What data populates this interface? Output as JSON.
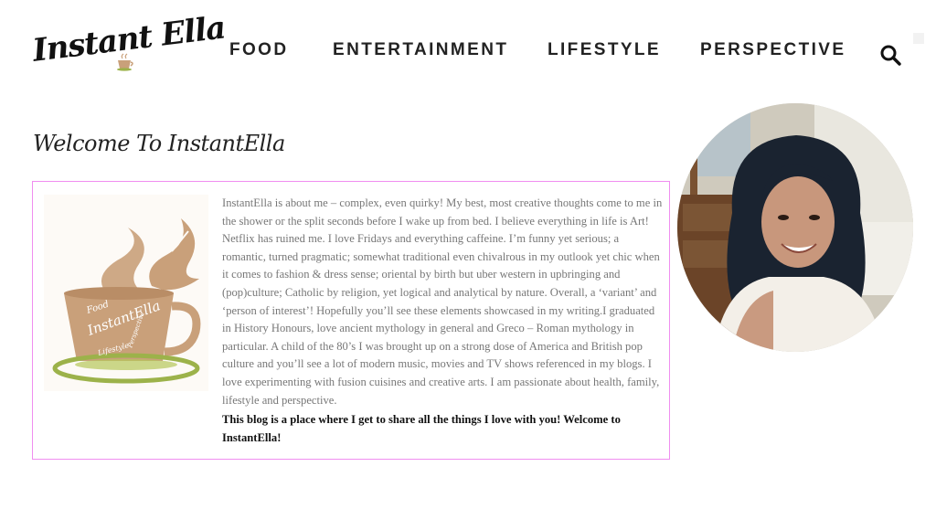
{
  "header": {
    "logo_text": "Instant Ella",
    "nav": [
      "FOOD",
      "ENTERTAINMENT",
      "LIFESTYLE",
      "PERSPECTIVE"
    ],
    "search_icon": "search-icon"
  },
  "main": {
    "welcome_title": "Welcome To InstantElla",
    "about_paragraph": "InstantElla is about me – complex, even quirky! My best, most creative thoughts come to me in the shower or the split seconds before I wake up from bed. I believe everything in life is Art! Netflix has ruined me. I love Fridays and everything caffeine. I’m funny yet serious; a romantic, turned pragmatic; somewhat traditional even chivalrous in my outlook yet chic when it comes to fashion & dress sense; oriental by birth but uber western in upbringing and (pop)culture; Catholic by religion, yet logical and analytical by nature. Overall, a ‘variant’ and ‘person of interest’! Hopefully you’ll see these elements showcased in my writing.I graduated in History Honours, love ancient mythology in general and Greco – Roman mythology in particular. A child of the 80’s I was brought up on a strong dose of America and British pop culture and you’ll see a lot of modern music, movies and TV shows referenced in my blogs. I love experimenting with fusion cuisines and creative arts. I am passionate about health, family, lifestyle and perspective.",
    "about_closing": "This blog is a place where I get to share all the things I love with you! Welcome to InstantElla!",
    "cup_words": [
      "Food",
      "InstantElla",
      "Perspective",
      "Lifestyle"
    ]
  },
  "colors": {
    "border_accent": "#f08ef0",
    "cup_brown": "#c9a07a",
    "saucer_green": "#9cb24a",
    "body_text": "#777777"
  }
}
